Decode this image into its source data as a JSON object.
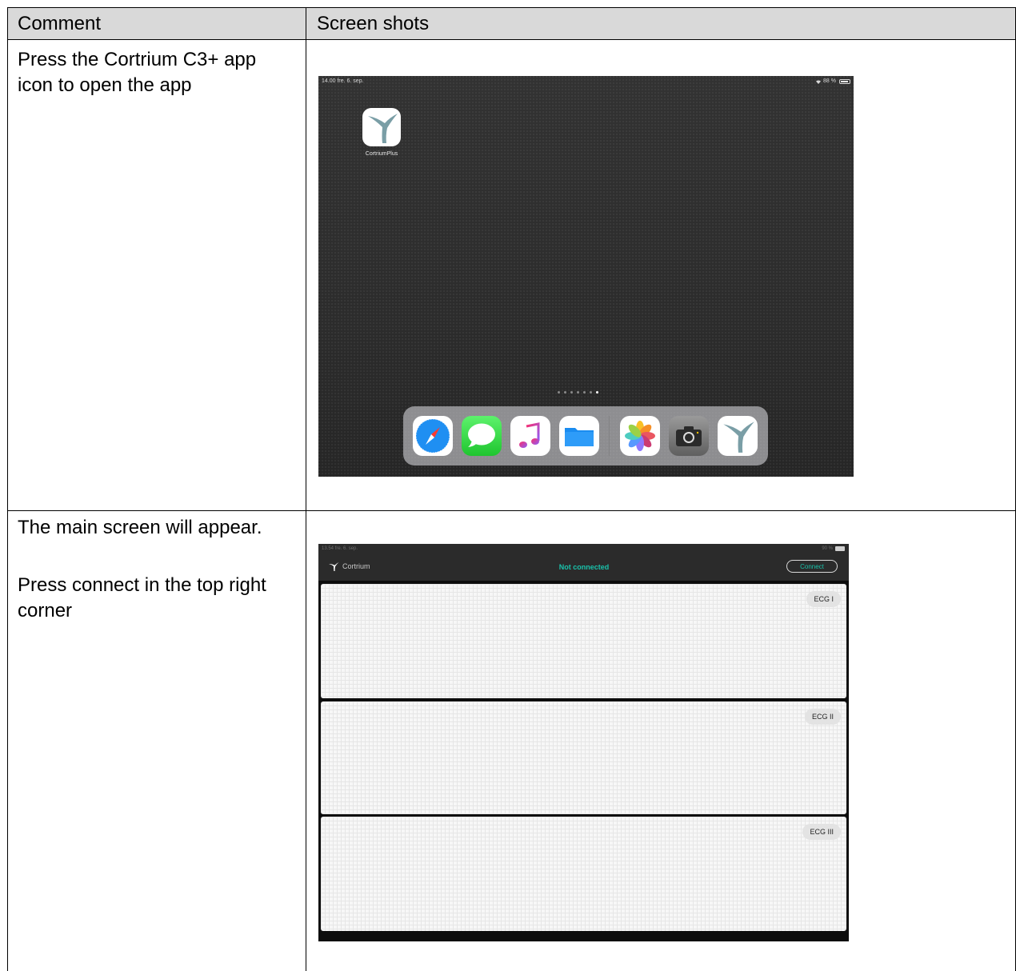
{
  "table": {
    "headers": [
      "Comment",
      "Screen shots"
    ],
    "rows": [
      {
        "comment": "Press the Cortrium C3+ app icon to open the app"
      },
      {
        "comment_line1": "The main screen will appear.",
        "comment_line2": "Press connect in the top right corner"
      }
    ]
  },
  "ipad_home": {
    "status_time": "14.00  fre. 6. sep.",
    "status_right": "88 %",
    "app_label": "CortriumPlus",
    "page_dots": 7,
    "active_dot": 7,
    "dock_apps": [
      "safari-icon",
      "messages-icon",
      "music-icon",
      "files-icon",
      "photos-icon",
      "camera-icon",
      "cortrium-icon"
    ]
  },
  "cortrium_main": {
    "status_time": "13.54  fre. 6. sep.",
    "status_right": "90 %",
    "brand": "Cortrium",
    "status": "Not connected",
    "connect_label": "Connect",
    "leads": [
      "ECG I",
      "ECG II",
      "ECG III"
    ],
    "colors": {
      "accent": "#19c1aa",
      "bar": "#2b2b2b"
    }
  }
}
